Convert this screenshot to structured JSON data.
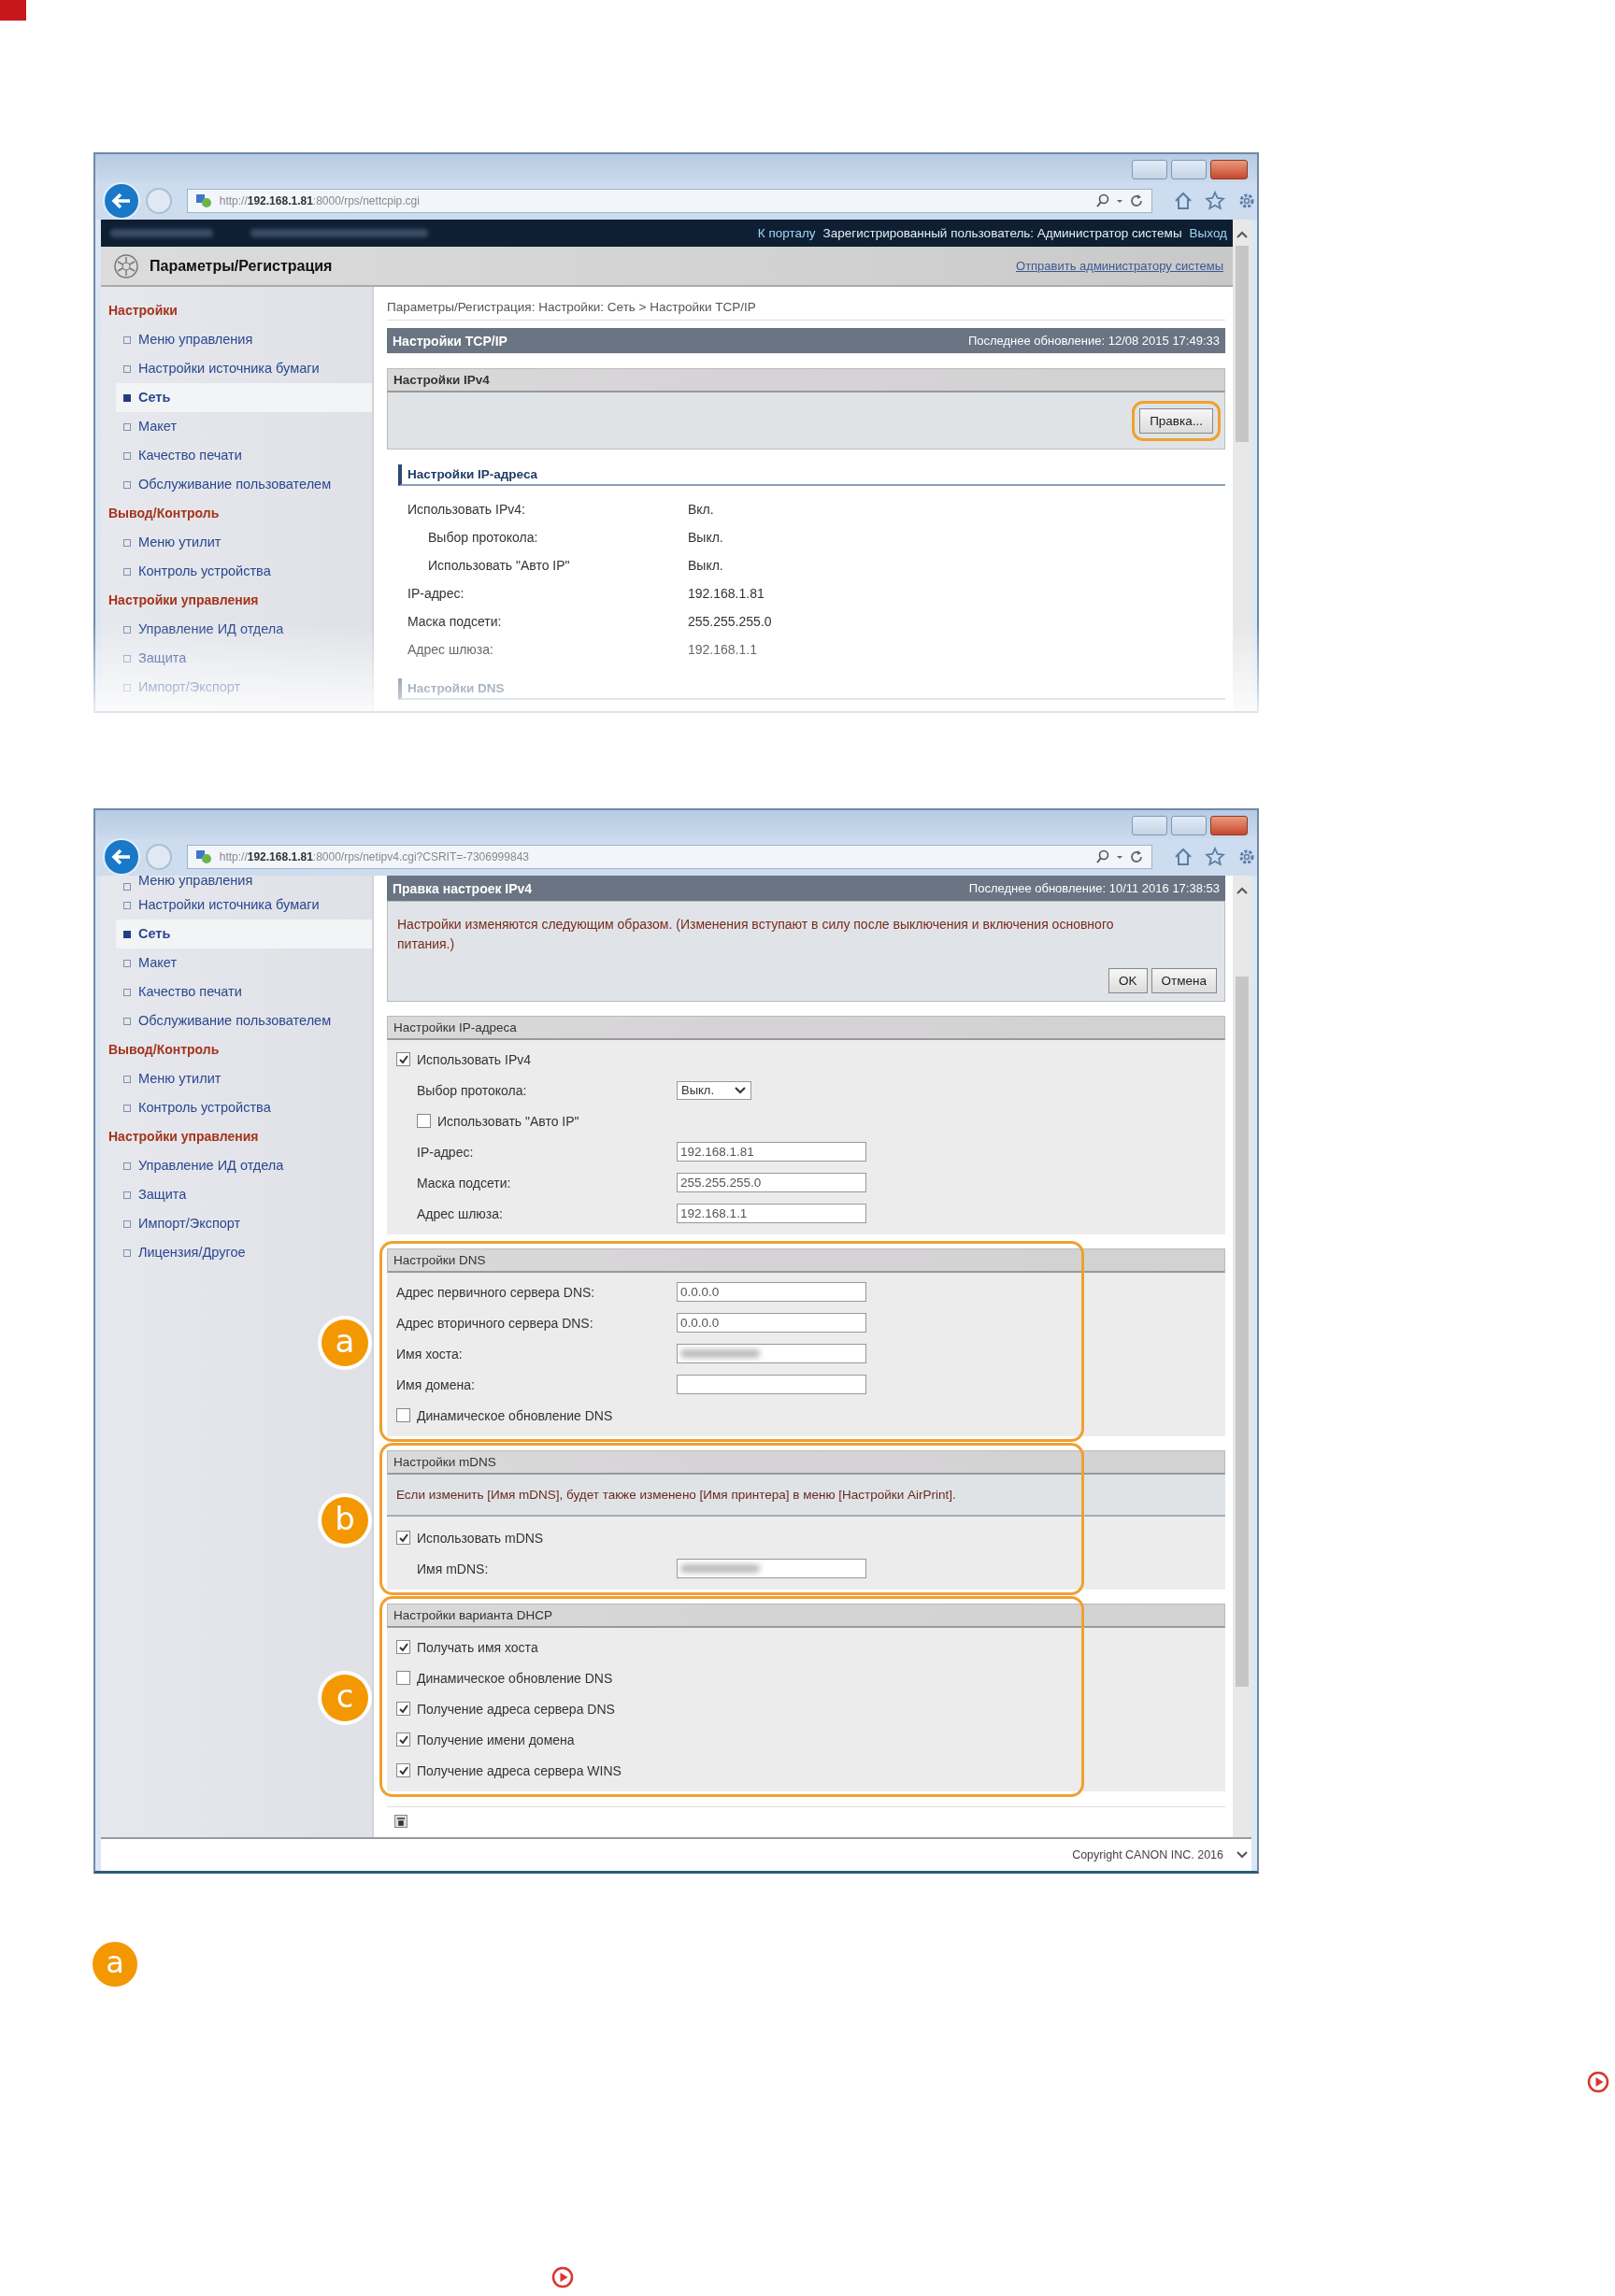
{
  "screenshot_1": {
    "url_prefix": "http://",
    "url_host": "192.168.1.81",
    "url_path": ":8000/rps/nettcpip.cgi",
    "top_bar": [
      {
        "kind": "link",
        "text": "К порталу"
      },
      {
        "kind": "text",
        "text": "Зарегистрированный пользователь: Администратор системы"
      },
      {
        "kind": "link",
        "text": "Выход"
      }
    ],
    "header_title": "Параметры/Регистрация",
    "header_link": "Отправить администратору системы",
    "sidebar": [
      {
        "kind": "heading",
        "label": "Настройки"
      },
      {
        "kind": "item",
        "label": "Меню управления",
        "selected": false
      },
      {
        "kind": "item",
        "label": "Настройки источника бумаги",
        "selected": false
      },
      {
        "kind": "item",
        "label": "Сеть",
        "selected": true
      },
      {
        "kind": "item",
        "label": "Макет",
        "selected": false
      },
      {
        "kind": "item",
        "label": "Качество печати",
        "selected": false
      },
      {
        "kind": "item",
        "label": "Обслуживание пользователем",
        "selected": false
      },
      {
        "kind": "heading",
        "label": "Вывод/Контроль"
      },
      {
        "kind": "item",
        "label": "Меню утилит",
        "selected": false
      },
      {
        "kind": "item",
        "label": "Контроль устройства",
        "selected": false
      },
      {
        "kind": "heading",
        "label": "Настройки управления"
      },
      {
        "kind": "item",
        "label": "Управление ИД отдела",
        "selected": false
      },
      {
        "kind": "item",
        "label": "Защита",
        "selected": false
      },
      {
        "kind": "item",
        "label": "Импорт/Экспорт",
        "selected": false
      }
    ],
    "breadcrumb": "Параметры/Регистрация: Настройки: Сеть > Настройки TCP/IP",
    "page_title": "Настройки TCP/IP",
    "last_updated": "Последнее обновление: 12/08 2015 17:49:33",
    "ipv4_panel": {
      "title": "Настройки IPv4",
      "button": "Правка...",
      "highlighted": true
    },
    "sections": [
      {
        "title": "Настройки IP-адреса",
        "rows": [
          {
            "kind": "text",
            "label": "Использовать IPv4:",
            "value": "Вкл.",
            "children": [
              {
                "kind": "text",
                "label": "Выбор протокола:",
                "value": "Выкл."
              },
              {
                "kind": "text",
                "label": "Использовать \"Авто IP\"",
                "value": "Выкл."
              }
            ]
          },
          {
            "kind": "text",
            "label": "IP-адрес:",
            "value": "192.168.1.81"
          },
          {
            "kind": "text",
            "label": "Маска подсети:",
            "value": "255.255.255.0"
          },
          {
            "kind": "text",
            "label": "Адрес шлюза:",
            "value": "192.168.1.1"
          }
        ]
      },
      {
        "title": "Настройки DNS"
      }
    ]
  },
  "screenshot_2": {
    "url_prefix": "http://",
    "url_host": "192.168.1.81",
    "url_path": ":8000/rps/netipv4.cgi?CSRIT=-7306999843",
    "sidebar": [
      {
        "kind": "item",
        "label": "Меню управления",
        "selected": false
      },
      {
        "kind": "item",
        "label": "Настройки источника бумаги",
        "selected": false
      },
      {
        "kind": "item",
        "label": "Сеть",
        "selected": true
      },
      {
        "kind": "item",
        "label": "Макет",
        "selected": false
      },
      {
        "kind": "item",
        "label": "Качество печати",
        "selected": false
      },
      {
        "kind": "item",
        "label": "Обслуживание пользователем",
        "selected": false
      },
      {
        "kind": "heading",
        "label": "Вывод/Контроль"
      },
      {
        "kind": "item",
        "label": "Меню утилит",
        "selected": false
      },
      {
        "kind": "item",
        "label": "Контроль устройства",
        "selected": false
      },
      {
        "kind": "heading",
        "label": "Настройки управления"
      },
      {
        "kind": "item",
        "label": "Управление ИД отдела",
        "selected": false
      },
      {
        "kind": "item",
        "label": "Защита",
        "selected": false
      },
      {
        "kind": "item",
        "label": "Импорт/Экспорт",
        "selected": false
      },
      {
        "kind": "item",
        "label": "Лицензия/Другое",
        "selected": false
      }
    ],
    "page_title": "Правка настроек IPv4",
    "last_updated": "Последнее обновление: 10/11 2016 17:38:53",
    "message": "Настройки изменяются следующим образом. (Изменения вступают в силу после выключения и включения основного питания.)",
    "buttons": [
      "OK",
      "Отмена"
    ],
    "sections": [
      {
        "title": "Настройки IP-адреса",
        "rows": [
          {
            "kind": "checkbox",
            "label": "Использовать IPv4",
            "checked": true,
            "children": [
              {
                "kind": "select",
                "label": "Выбор протокола:",
                "value": "Выкл."
              },
              {
                "kind": "checkbox",
                "label": "Использовать \"Авто IP\"",
                "checked": false
              },
              {
                "kind": "field",
                "label": "IP-адрес:",
                "value": "192.168.1.81"
              },
              {
                "kind": "field",
                "label": "Маска подсети:",
                "value": "255.255.255.0"
              },
              {
                "kind": "field",
                "label": "Адрес шлюза:",
                "value": "192.168.1.1"
              }
            ]
          }
        ]
      },
      {
        "title": "Настройки DNS",
        "badge": "a",
        "rows": [
          {
            "kind": "field",
            "label": "Адрес первичного сервера DNS:",
            "value": "0.0.0.0"
          },
          {
            "kind": "field",
            "label": "Адрес вторичного сервера DNS:",
            "value": "0.0.0.0"
          },
          {
            "kind": "field",
            "label": "Имя хоста:",
            "blurred": true
          },
          {
            "kind": "field",
            "label": "Имя домена:"
          },
          {
            "kind": "checkbox",
            "label": "Динамическое обновление DNS",
            "checked": false
          }
        ]
      },
      {
        "title": "Настройки mDNS",
        "badge": "b",
        "note": "Если изменить [Имя mDNS], будет также изменено [Имя принтера] в меню [Настройки AirPrint].",
        "rows": [
          {
            "kind": "checkbox",
            "label": "Использовать mDNS",
            "checked": true,
            "children": [
              {
                "kind": "field",
                "label": "Имя mDNS:",
                "blurred": true
              }
            ]
          }
        ]
      },
      {
        "title": "Настройки варианта DHCP",
        "badge": "c",
        "rows": [
          {
            "kind": "checkbox",
            "label": "Получать имя хоста",
            "checked": true
          },
          {
            "kind": "checkbox",
            "label": "Динамическое обновление DNS",
            "checked": false
          },
          {
            "kind": "checkbox",
            "label": "Получение адреса сервера DNS",
            "checked": true
          },
          {
            "kind": "checkbox",
            "label": "Получение имени домена",
            "checked": true
          },
          {
            "kind": "checkbox",
            "label": "Получение адреса сервера WINS",
            "checked": true
          }
        ]
      }
    ],
    "copyright": "Copyright CANON INC. 2016"
  },
  "footer_badge": "a"
}
